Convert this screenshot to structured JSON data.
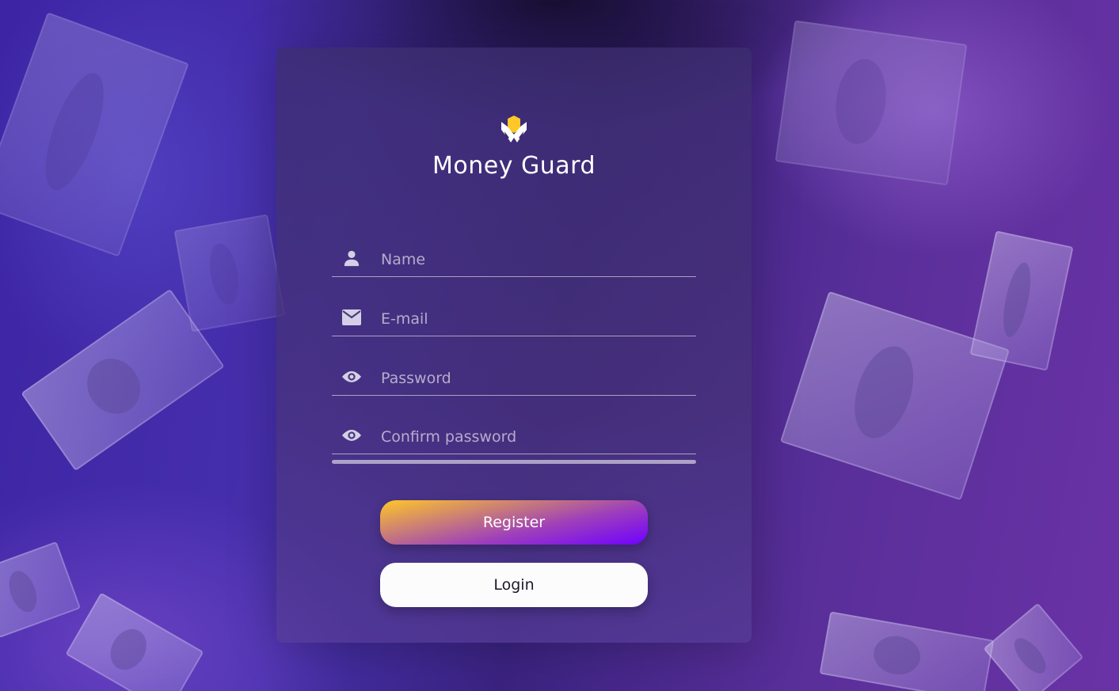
{
  "app": {
    "title": "Money Guard"
  },
  "form": {
    "name_placeholder": "Name",
    "email_placeholder": "E-mail",
    "password_placeholder": "Password",
    "confirm_placeholder": "Confirm password"
  },
  "buttons": {
    "register_label": "Register",
    "login_label": "Login"
  },
  "icons": {
    "name": "user-icon",
    "email": "envelope-icon",
    "password": "eye-icon",
    "confirm": "eye-icon",
    "logo": "shield-logo-icon"
  },
  "colors": {
    "accent_gradient_start": "#ffc727",
    "accent_gradient_mid": "#9e40ba",
    "accent_gradient_end": "#7000ff",
    "logo_accent": "#ffc727"
  }
}
